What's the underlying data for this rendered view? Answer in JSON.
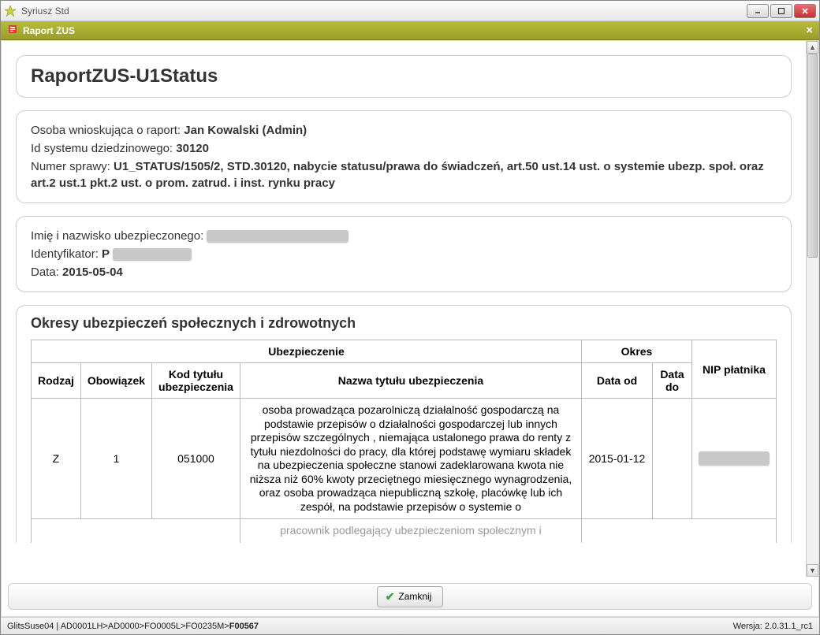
{
  "window": {
    "title": "Syriusz Std"
  },
  "tab": {
    "title": "Raport ZUS"
  },
  "report": {
    "title": "RaportZUS-U1Status"
  },
  "requester": {
    "label": "Osoba wnioskująca o raport: ",
    "value": "Jan Kowalski (Admin)"
  },
  "system_id": {
    "label": "Id systemu dziedzinowego: ",
    "value": "30120"
  },
  "case_no": {
    "label": "Numer sprawy: ",
    "value": "U1_STATUS/1505/2, STD.30120, nabycie statusu/prawa do świadczeń, art.50 ust.14 ust. o systemie ubezp. społ. oraz art.2 ust.1 pkt.2 ust. o prom. zatrud. i inst. rynku pracy"
  },
  "insured": {
    "name_label": "Imię i nazwisko ubezpieczonego: ",
    "id_label": "Identyfikator: ",
    "id_prefix": "P",
    "date_label": "Data: ",
    "date_value": "2015-05-04"
  },
  "section": {
    "title": "Okresy ubezpieczeń społecznych i zdrowotnych"
  },
  "table": {
    "headers": {
      "ubezpieczenie": "Ubezpieczenie",
      "okres": "Okres",
      "nip": "NIP płatnika",
      "rodzaj": "Rodzaj",
      "obowiazek": "Obowiązek",
      "kod": "Kod tytułu ubezpieczenia",
      "nazwa": "Nazwa tytułu ubezpieczenia",
      "data_od": "Data od",
      "data_do": "Data do"
    },
    "rows": [
      {
        "rodzaj": "Z",
        "obowiazek": "1",
        "kod": "051000",
        "nazwa": "osoba prowadząca pozarolniczą działalność gospodarczą na podstawie przepisów o działalności gospodarczej lub innych przepisów szczególnych , niemająca ustalonego prawa do renty z tytułu niezdolności do pracy, dla której podstawę wymiaru składek na ubezpieczenia społeczne stanowi zadeklarowana kwota nie niższa niż 60% kwoty przeciętnego miesięcznego wynagrodzenia, oraz osoba prowadząca niepubliczną szkołę, placówkę lub ich zespół, na podstawie przepisów o systemie o",
        "data_od": "2015-01-12",
        "data_do": ""
      }
    ],
    "partial_row": "pracownik podlegający ubezpieczeniom społecznym i"
  },
  "button": {
    "close": "Zamknij"
  },
  "status": {
    "host": "GlitsSuse04",
    "path_prefix": "AD0001LH>AD0000>FO0005L>FO0235M>",
    "path_current": "F00567",
    "version_label": "Wersja: ",
    "version": "2.0.31.1_rc1"
  }
}
